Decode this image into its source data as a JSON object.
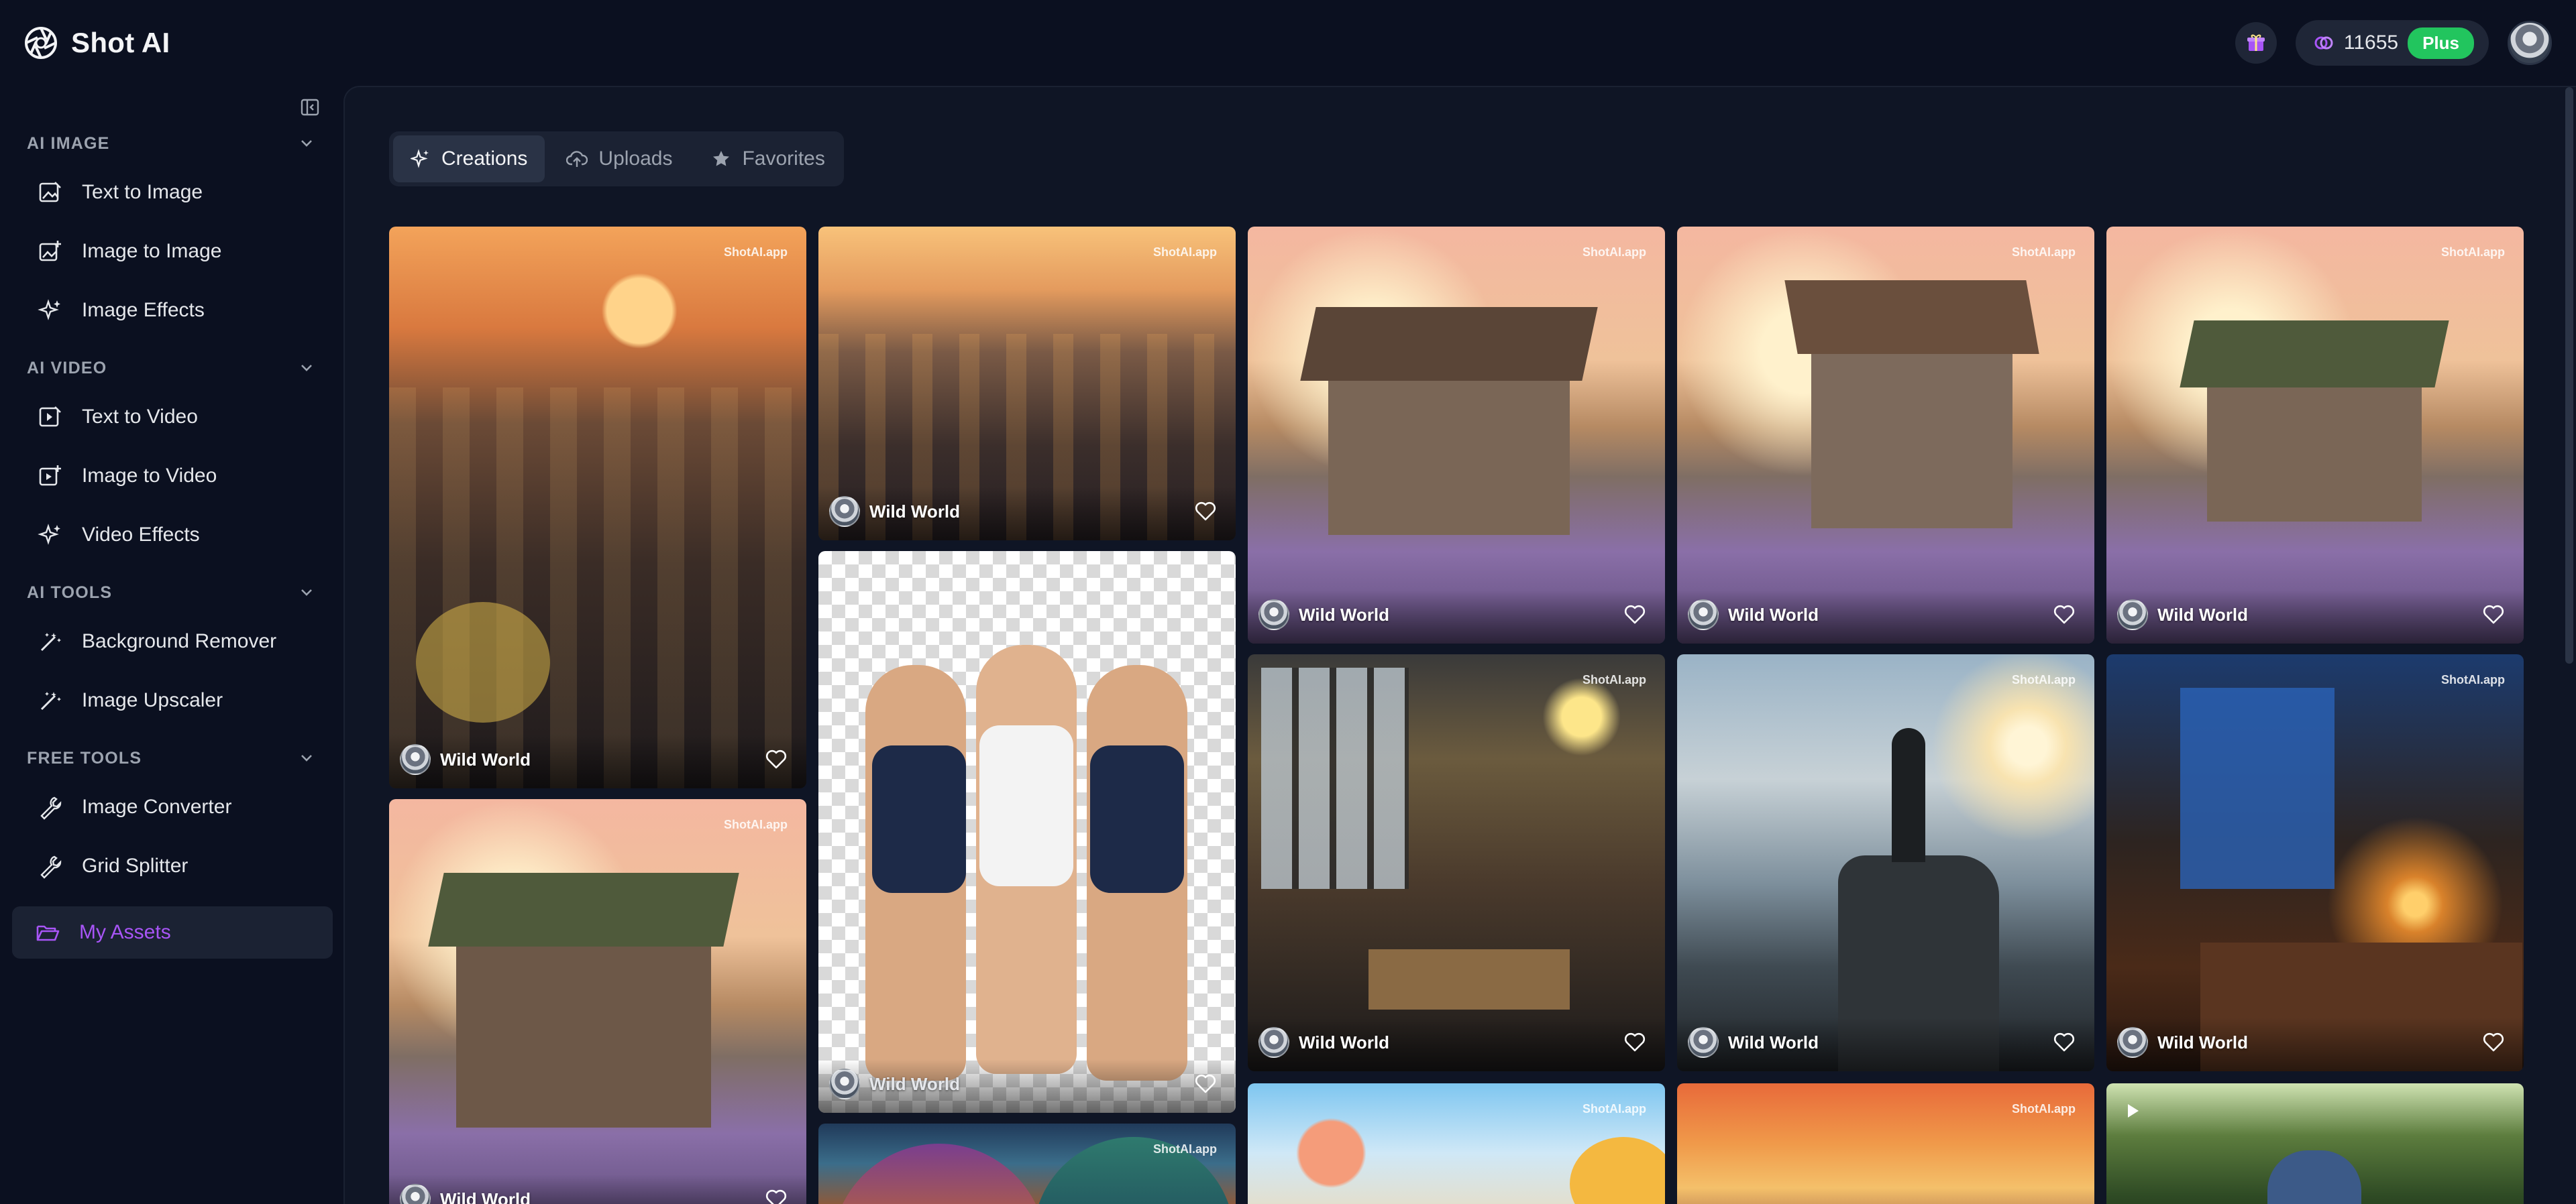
{
  "app": {
    "name": "Shot AI",
    "credits": "11655",
    "plan_badge": "Plus"
  },
  "sidebar": {
    "sections": [
      {
        "title": "AI IMAGE",
        "items": [
          "Text to Image",
          "Image to Image",
          "Image Effects"
        ]
      },
      {
        "title": "AI VIDEO",
        "items": [
          "Text to Video",
          "Image to Video",
          "Video Effects"
        ]
      },
      {
        "title": "AI TOOLS",
        "items": [
          "Background Remover",
          "Image Upscaler"
        ]
      },
      {
        "title": "FREE TOOLS",
        "items": [
          "Image Converter",
          "Grid Splitter"
        ]
      }
    ],
    "active_item": "My Assets"
  },
  "tabs": [
    {
      "label": "Creations",
      "icon": "sparkle-icon",
      "active": true
    },
    {
      "label": "Uploads",
      "icon": "cloud-upload-icon",
      "active": false
    },
    {
      "label": "Favorites",
      "icon": "star-icon",
      "active": false
    }
  ],
  "gallery": {
    "watermark": "ShotAI.app",
    "cards": [
      {
        "user": "Wild World",
        "subject": "market"
      },
      {
        "user": "Wild World",
        "subject": "market"
      },
      {
        "user": "Wild World",
        "subject": "cottage"
      },
      {
        "user": "Wild World",
        "subject": "cottage"
      },
      {
        "user": "Wild World",
        "subject": "cottage"
      },
      {
        "user": "Wild World",
        "subject": "cottage"
      },
      {
        "user": "Wild World",
        "subject": "background-removed"
      },
      {
        "user": "Wild World",
        "subject": "cafe"
      },
      {
        "user": "Wild World",
        "subject": "cliff"
      },
      {
        "user": "Wild World",
        "subject": "candle"
      },
      {
        "user": "",
        "subject": "mushroom"
      },
      {
        "user": "",
        "subject": "flowers"
      },
      {
        "user": "",
        "subject": "sunset"
      },
      {
        "user": "",
        "subject": "forest"
      }
    ]
  }
}
